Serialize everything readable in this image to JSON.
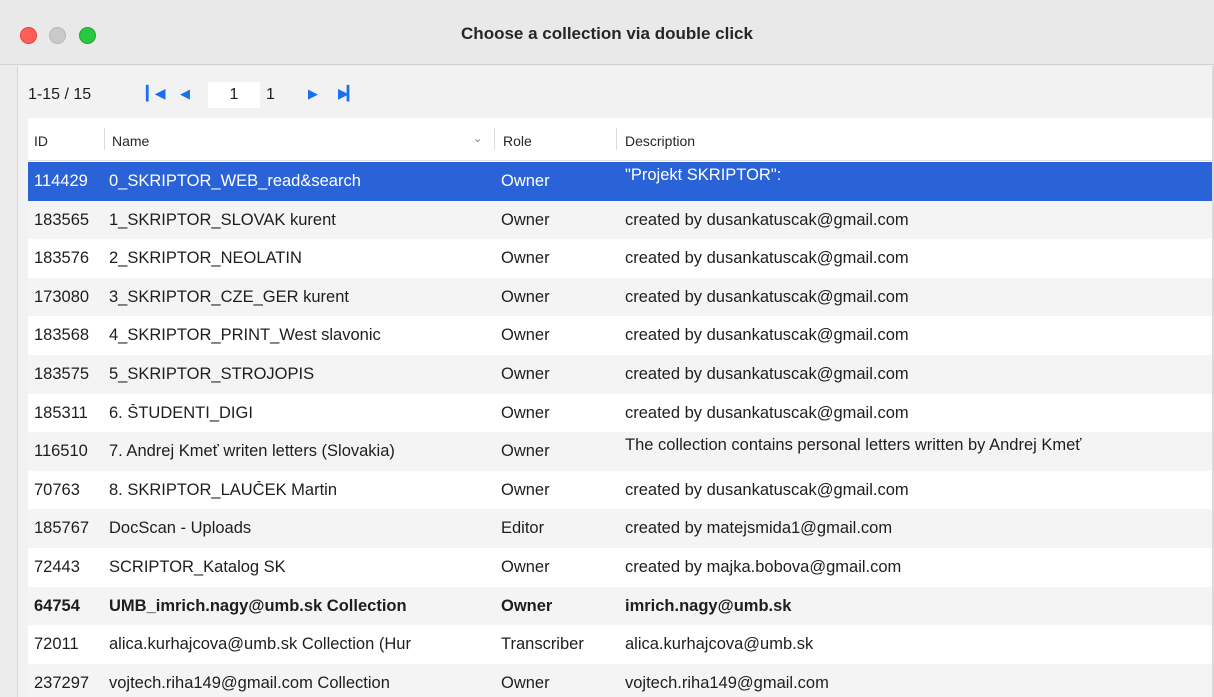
{
  "window": {
    "title": "Choose a collection via double click"
  },
  "pager": {
    "range": "1-15 / 15",
    "first_icon": "first-page-icon",
    "prev_icon": "previous-page-icon",
    "page_value": "1",
    "total_pages": "1",
    "next_icon": "next-page-icon",
    "last_icon": "last-page-icon",
    "accent_color": "#1a6ff0"
  },
  "table": {
    "headers": {
      "id": "ID",
      "name": "Name",
      "role": "Role",
      "description": "Description"
    },
    "sort_icon": "chevron-down-icon",
    "selection_color": "#2a62d8",
    "rows": [
      {
        "id": "114429",
        "name": "0_SKRIPTOR_WEB_read&search",
        "role": "Owner",
        "description": "\"Projekt SKRIPTOR\":"
      },
      {
        "id": "183565",
        "name": "1_SKRIPTOR_SLOVAK kurent",
        "role": "Owner",
        "description": "created by dusankatuscak@gmail.com"
      },
      {
        "id": "183576",
        "name": "2_SKRIPTOR_NEOLATIN",
        "role": "Owner",
        "description": "created by dusankatuscak@gmail.com"
      },
      {
        "id": "173080",
        "name": "3_SKRIPTOR_CZE_GER kurent",
        "role": "Owner",
        "description": "created by dusankatuscak@gmail.com"
      },
      {
        "id": "183568",
        "name": "4_SKRIPTOR_PRINT_West slavonic",
        "role": "Owner",
        "description": "created by dusankatuscak@gmail.com"
      },
      {
        "id": "183575",
        "name": "5_SKRIPTOR_STROJOPIS",
        "role": "Owner",
        "description": "created by dusankatuscak@gmail.com"
      },
      {
        "id": "185311",
        "name": "6. ŠTUDENTI_DIGI",
        "role": "Owner",
        "description": "created by dusankatuscak@gmail.com"
      },
      {
        "id": "116510",
        "name": "7. Andrej Kmeť writen letters (Slovakia)",
        "role": "Owner",
        "description": "The collection contains personal letters written by Andrej Kmeť"
      },
      {
        "id": "70763",
        "name": "8. SKRIPTOR_LAUČEK Martin",
        "role": "Owner",
        "description": "created by dusankatuscak@gmail.com"
      },
      {
        "id": "185767",
        "name": "DocScan - Uploads",
        "role": "Editor",
        "description": "created by matejsmida1@gmail.com"
      },
      {
        "id": "72443",
        "name": "SCRIPTOR_Katalog SK",
        "role": "Owner",
        "description": "created by majka.bobova@gmail.com"
      },
      {
        "id": "64754",
        "name": "UMB_imrich.nagy@umb.sk Collection",
        "role": "Owner",
        "description": "imrich.nagy@umb.sk"
      },
      {
        "id": "72011",
        "name": "alica.kurhajcova@umb.sk Collection (Hur",
        "role": "Transcriber",
        "description": "alica.kurhajcova@umb.sk"
      },
      {
        "id": "237297",
        "name": "vojtech.riha149@gmail.com Collection",
        "role": "Owner",
        "description": "vojtech.riha149@gmail.com"
      }
    ]
  }
}
